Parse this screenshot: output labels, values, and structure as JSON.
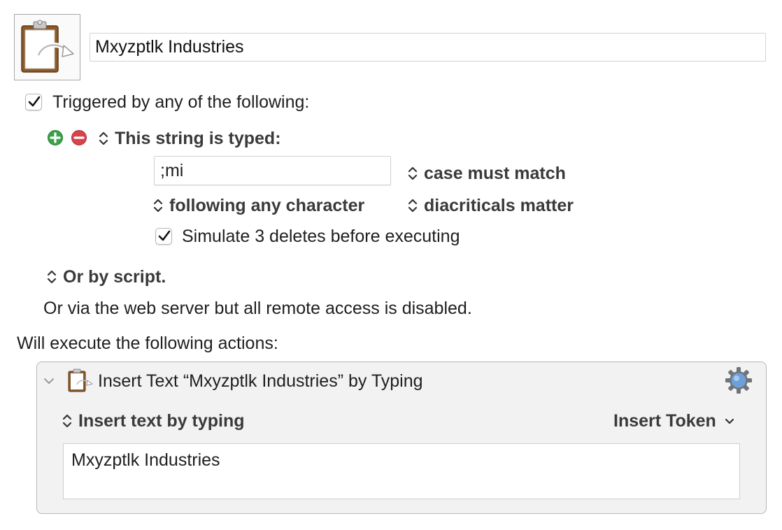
{
  "macro": {
    "name": "Mxyzptlk Industries",
    "icon": "clipboard-insert-icon"
  },
  "trigger": {
    "enabled": true,
    "header_label": "Triggered by any of the following:",
    "string_trigger_label": "This string is typed:",
    "typed_string": ";mi",
    "case_option": "case must match",
    "following_option": "following any character",
    "diacriticals_option": "diacriticals matter",
    "simulate_deletes_checked": true,
    "simulate_deletes_label": "Simulate 3 deletes before executing",
    "script_label": "Or by script.",
    "web_server_text": "Or via the web server but all remote access is disabled."
  },
  "actions": {
    "header_label": "Will execute the following actions:",
    "items": [
      {
        "title": "Insert Text “Mxyzptlk Industries” by Typing",
        "mode_label": "Insert text by typing",
        "insert_token_label": "Insert Token",
        "text_value": "Mxyzptlk Industries",
        "icon": "clipboard-insert-icon"
      }
    ]
  },
  "colors": {
    "add_green": "#3aa34a",
    "remove_red": "#d9434b",
    "gear_blue": "#6d9fd8",
    "panel_bg": "#f2f2f2"
  }
}
